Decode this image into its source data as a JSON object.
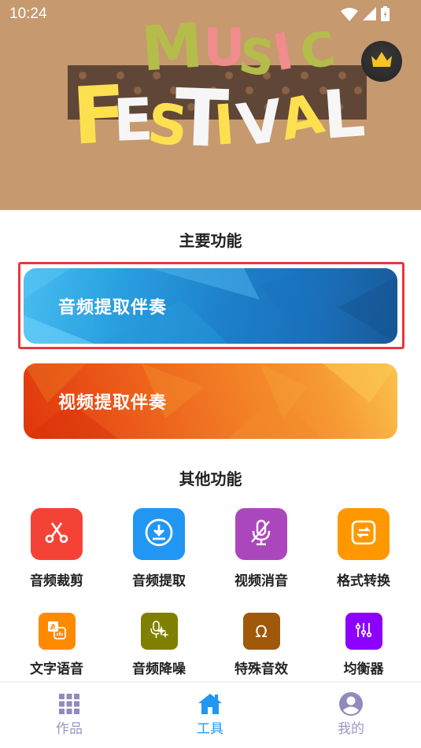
{
  "status_bar": {
    "time": "10:24",
    "icons": [
      "wifi-icon",
      "cellular-signal-icon",
      "battery-charging-icon"
    ]
  },
  "banner": {
    "title_top": "MUSIC",
    "title_bottom": "FESTIVAL",
    "vip_icon": "crown-icon"
  },
  "main_section": {
    "title": "主要功能",
    "cards": [
      {
        "label": "音频提取伴奏",
        "theme": "blue",
        "selected": true
      },
      {
        "label": "视频提取伴奏",
        "theme": "orange",
        "selected": false
      }
    ]
  },
  "other_section": {
    "title": "其他功能",
    "tools": [
      {
        "label": "音频裁剪",
        "icon": "scissors-icon",
        "color": "#f44336"
      },
      {
        "label": "音频提取",
        "icon": "download-circle-icon",
        "color": "#2196f3"
      },
      {
        "label": "视频消音",
        "icon": "mic-off-icon",
        "color": "#ab47bc"
      },
      {
        "label": "格式转换",
        "icon": "convert-icon",
        "color": "#ff9800"
      },
      {
        "label": "文字语音",
        "icon": "text-to-speech-icon",
        "color": "#ff8a00"
      },
      {
        "label": "音频降噪",
        "icon": "mic-sparkle-icon",
        "color": "#808000"
      },
      {
        "label": "特殊音效",
        "icon": "omega-icon",
        "color": "#a0580a"
      },
      {
        "label": "均衡器",
        "icon": "equalizer-icon",
        "color": "#8b00ff"
      }
    ]
  },
  "bottom_nav": {
    "items": [
      {
        "label": "作品",
        "icon": "grid-icon",
        "active": false
      },
      {
        "label": "工具",
        "icon": "home-icon",
        "active": true
      },
      {
        "label": "我的",
        "icon": "account-icon",
        "active": false
      }
    ],
    "active_color": "#2196f3",
    "inactive_color": "#9a96c4"
  }
}
